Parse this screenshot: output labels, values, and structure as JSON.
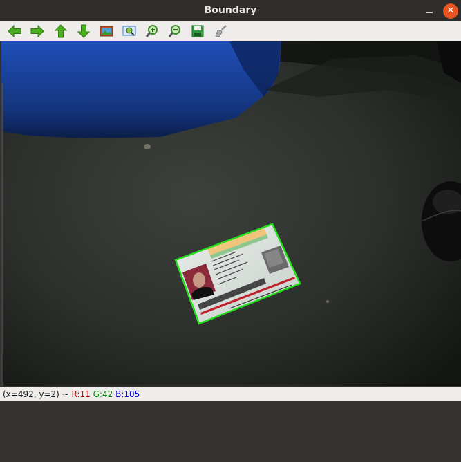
{
  "window": {
    "title": "Boundary",
    "close_symbol": "✕"
  },
  "toolbar": {
    "icons": [
      {
        "name": "arrow-left-icon",
        "color": "#4caf1f"
      },
      {
        "name": "arrow-right-icon",
        "color": "#4caf1f"
      },
      {
        "name": "arrow-up-icon",
        "color": "#4caf1f"
      },
      {
        "name": "arrow-down-icon",
        "color": "#4caf1f"
      },
      {
        "name": "image-icon",
        "color": "#c0502a"
      },
      {
        "name": "zoom-fit-icon",
        "color": "#3b7bd0"
      },
      {
        "name": "zoom-in-icon",
        "color": "#3a8a2a"
      },
      {
        "name": "zoom-out-icon",
        "color": "#3a8a2a"
      },
      {
        "name": "save-icon",
        "color": "#2e9c3a"
      },
      {
        "name": "brush-icon",
        "color": "#9a9a9a"
      }
    ]
  },
  "status": {
    "coords": "(x=492, y=2) ~ ",
    "r": "R:11",
    "g": "G:42",
    "b": "B:105",
    "r_color": "#e00000",
    "g_color": "#008a00",
    "b_color": "#0000e0"
  },
  "image": {
    "boundary_color": "#22e01a"
  }
}
